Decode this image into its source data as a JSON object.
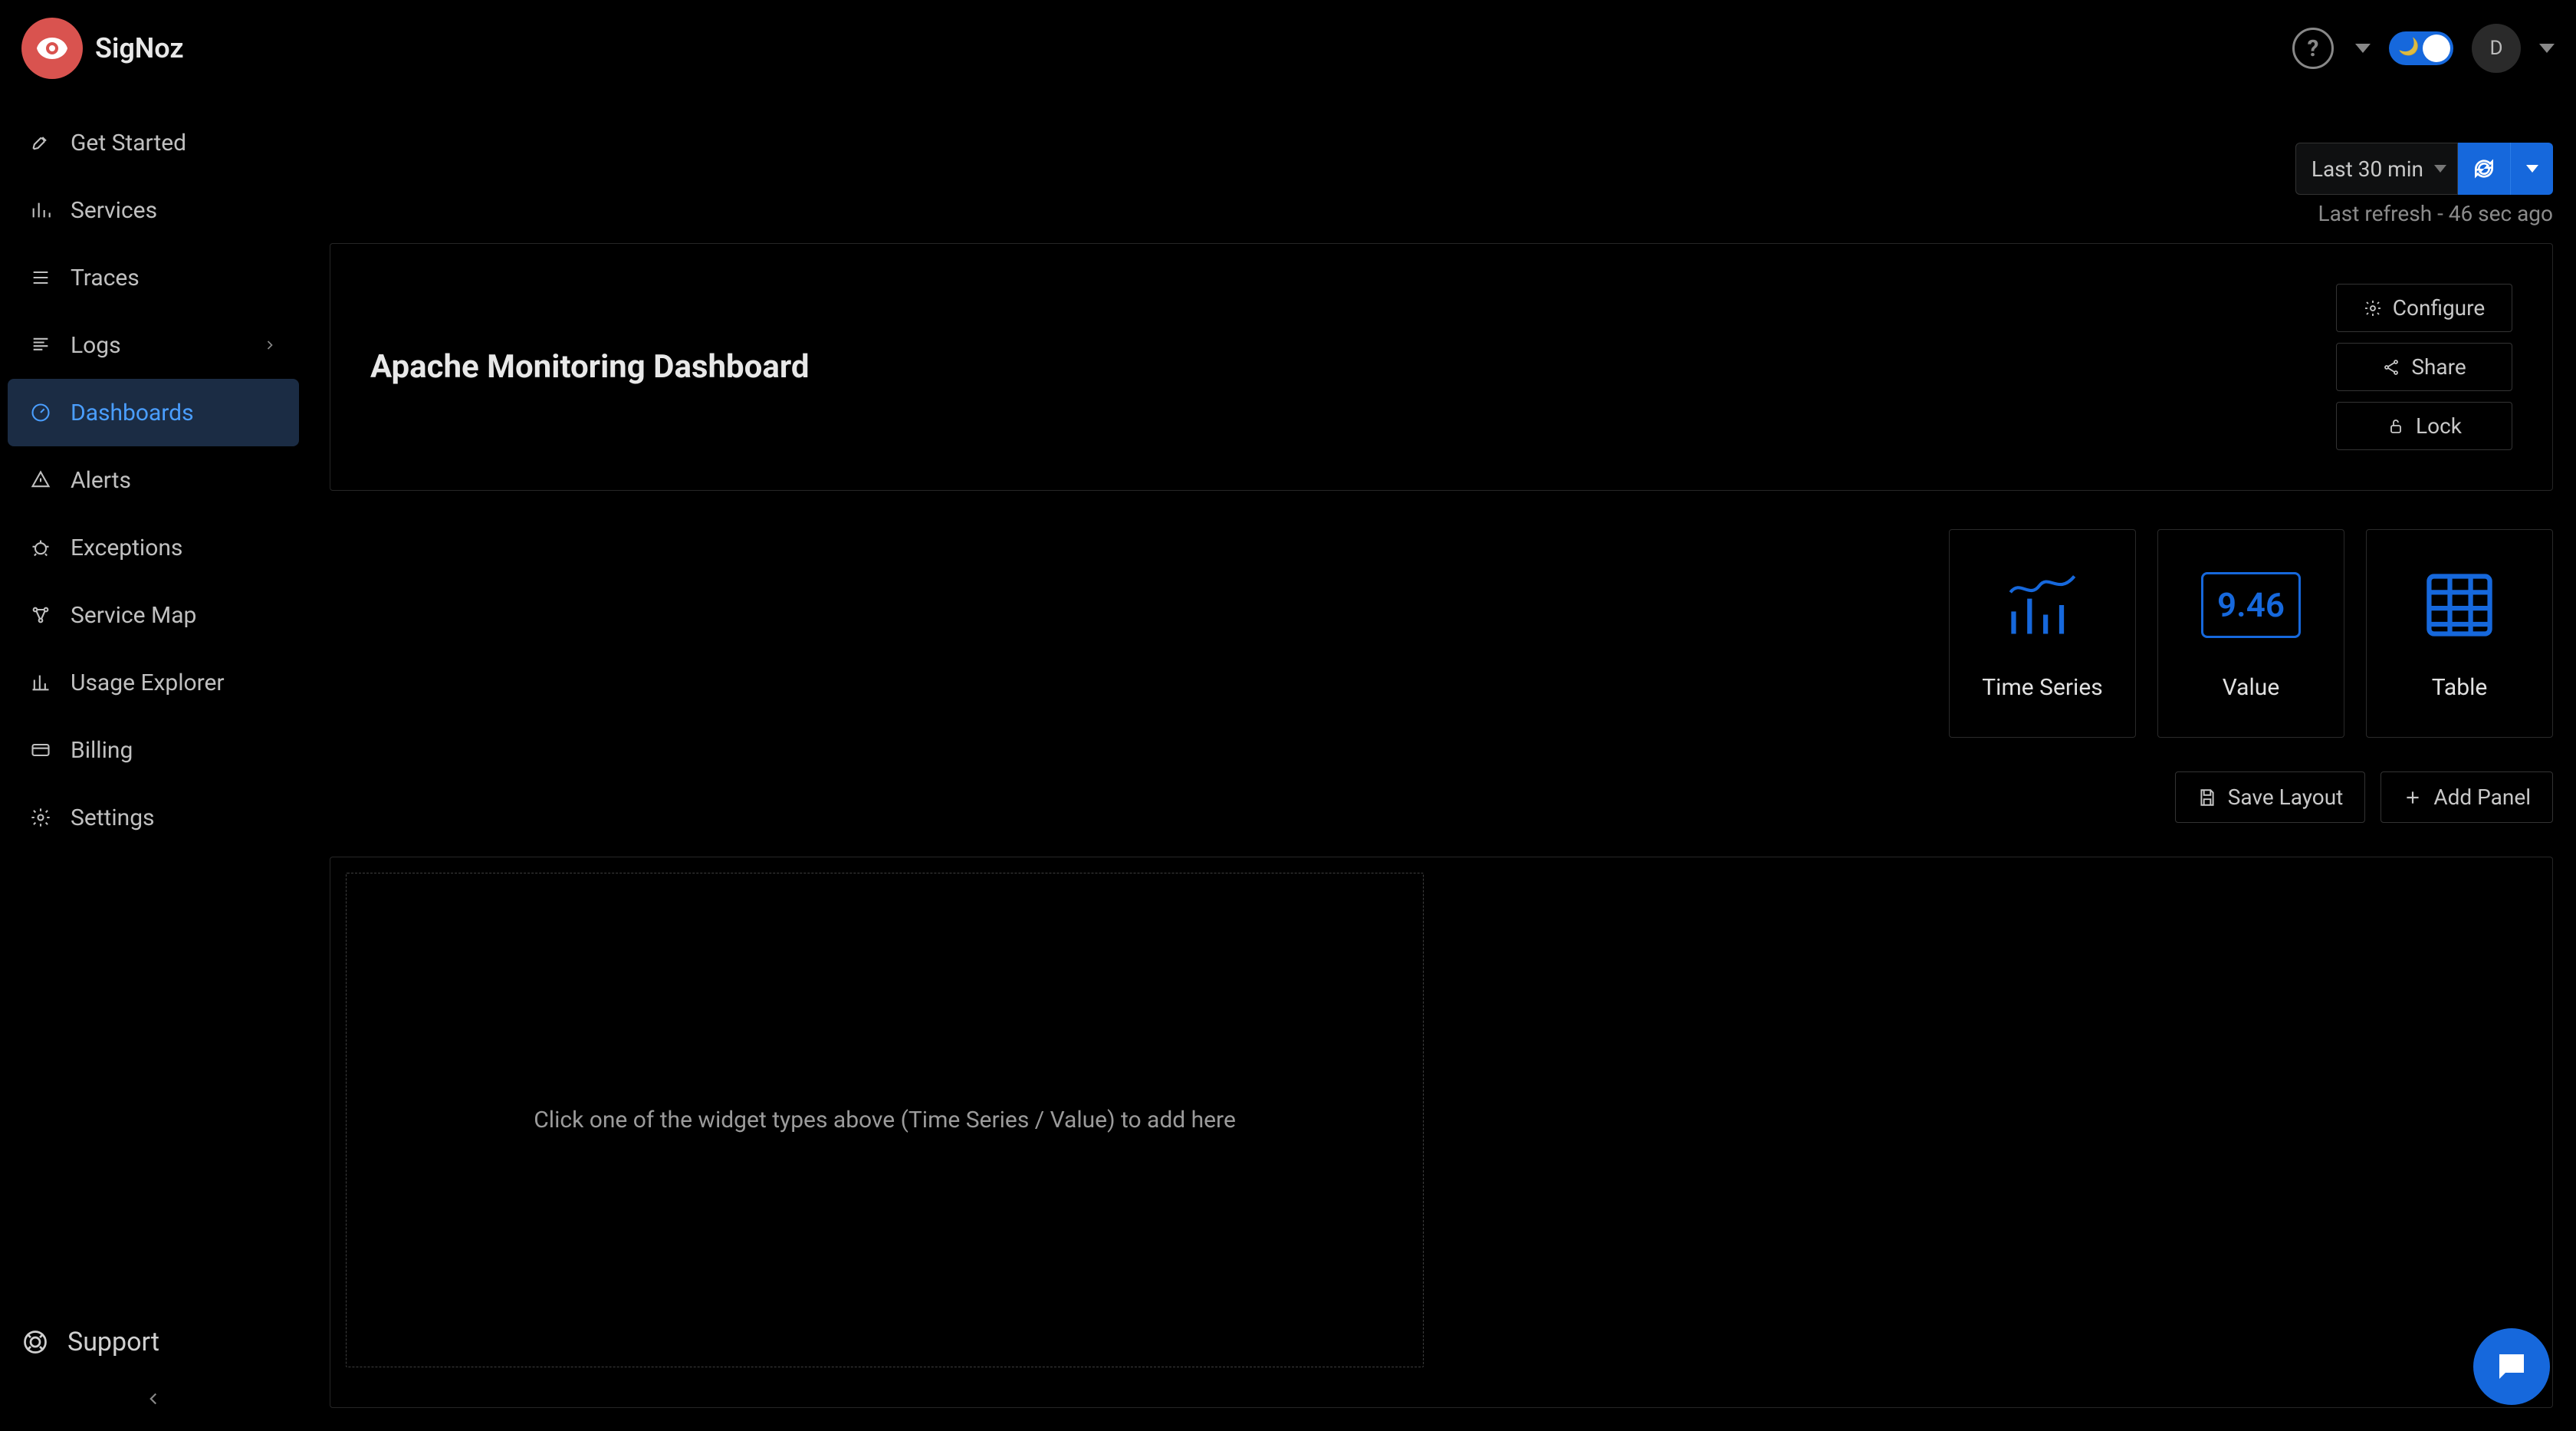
{
  "brand": {
    "name": "SigNoz"
  },
  "topbar": {
    "avatar_initial": "D"
  },
  "sidebar": {
    "nav": [
      {
        "label": "Get Started",
        "icon": "rocket"
      },
      {
        "label": "Services",
        "icon": "bars"
      },
      {
        "label": "Traces",
        "icon": "list"
      },
      {
        "label": "Logs",
        "icon": "lines",
        "expandable": true
      },
      {
        "label": "Dashboards",
        "icon": "dashboard",
        "active": true
      },
      {
        "label": "Alerts",
        "icon": "alert"
      },
      {
        "label": "Exceptions",
        "icon": "bug"
      },
      {
        "label": "Service Map",
        "icon": "network"
      },
      {
        "label": "Usage Explorer",
        "icon": "chart"
      },
      {
        "label": "Billing",
        "icon": "card"
      },
      {
        "label": "Settings",
        "icon": "gear"
      }
    ],
    "support_label": "Support"
  },
  "toolbar": {
    "time_range": "Last 30 min",
    "last_refresh": "Last refresh - 46 sec ago"
  },
  "dashboard": {
    "title": "Apache Monitoring Dashboard",
    "actions": {
      "configure": "Configure",
      "share": "Share",
      "lock": "Lock"
    }
  },
  "widget_types": {
    "time_series": "Time Series",
    "value": {
      "label": "Value",
      "sample": "9.46"
    },
    "table": "Table"
  },
  "layout_buttons": {
    "save": "Save Layout",
    "add_panel": "Add Panel"
  },
  "canvas": {
    "placeholder": "Click one of the widget types above (Time Series / Value) to add here"
  }
}
